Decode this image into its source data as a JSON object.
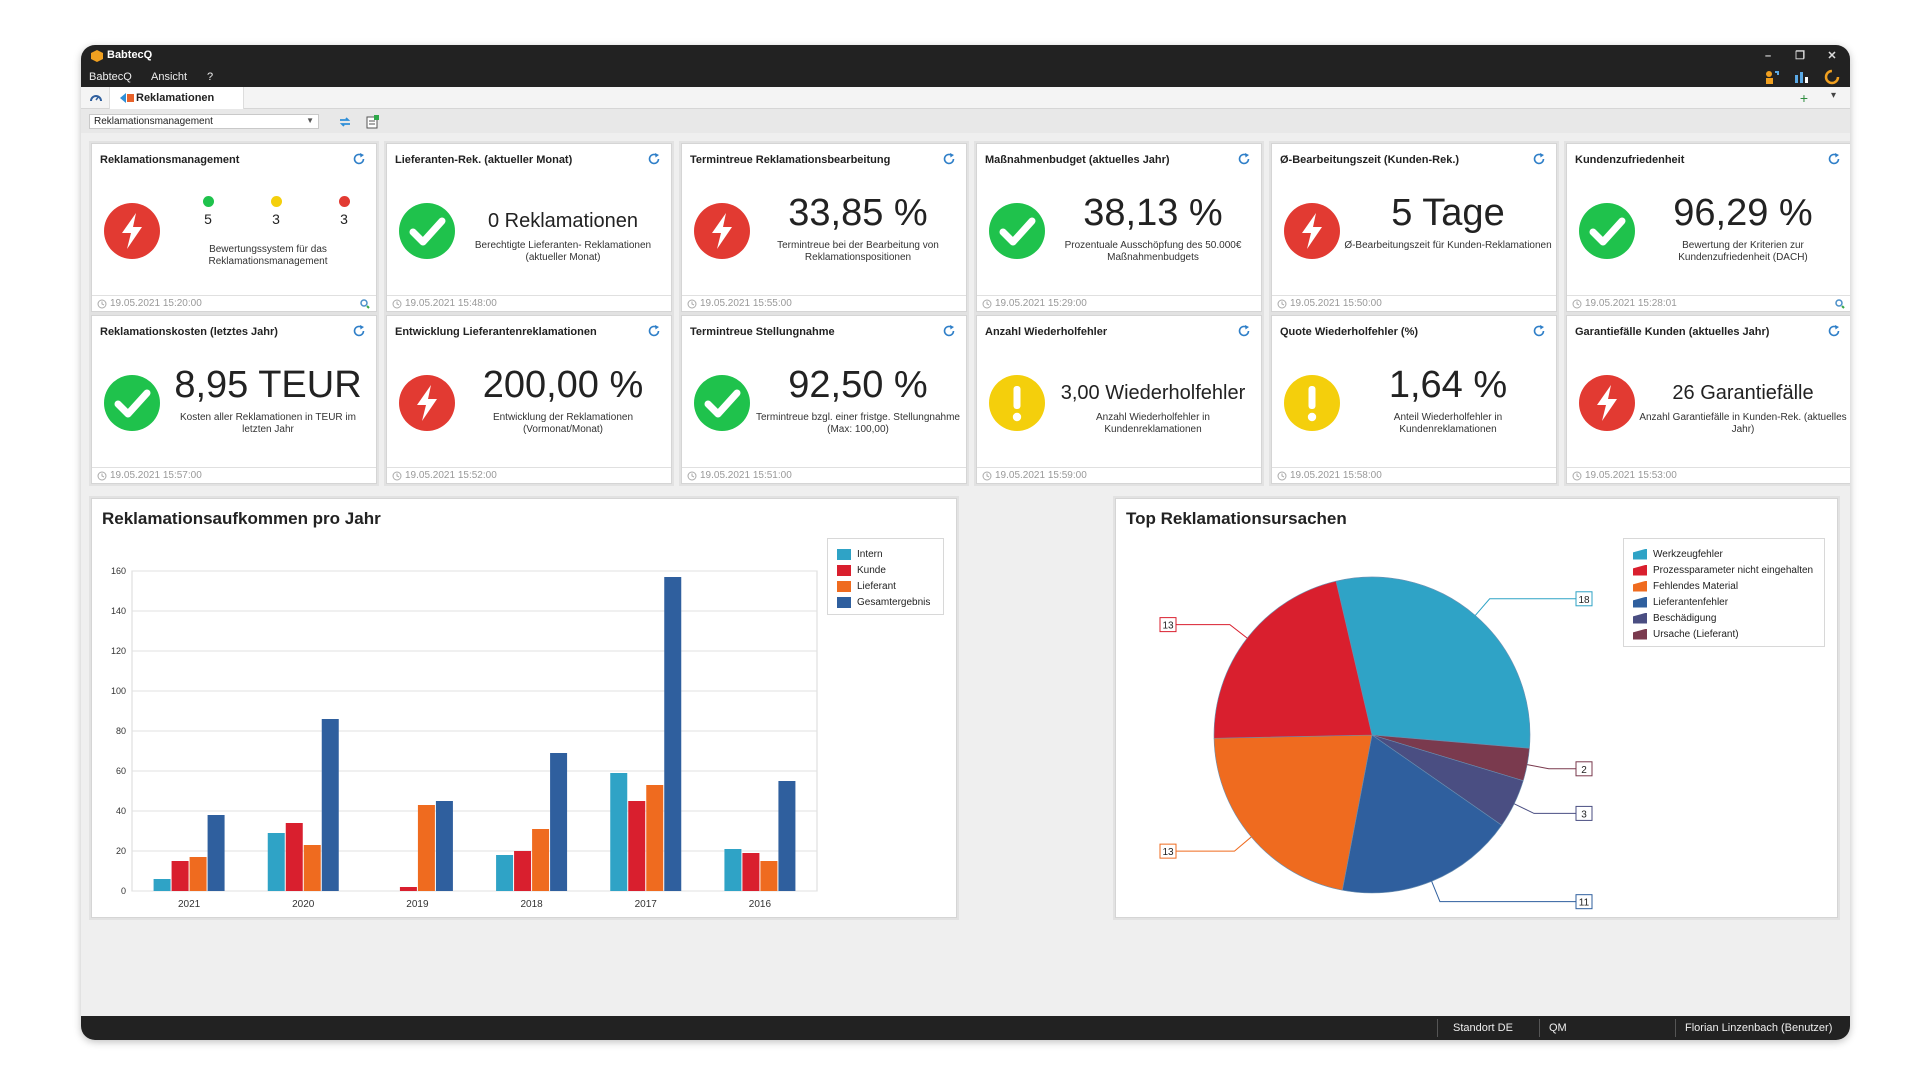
{
  "window": {
    "title": "BabtecQ",
    "controls": {
      "minimize": "–",
      "restore": "❐",
      "close": "✕"
    }
  },
  "menu": {
    "items": [
      "BabtecQ",
      "Ansicht",
      "?"
    ]
  },
  "tabs": {
    "active": "Reklamationen",
    "add": "+",
    "more": "▾"
  },
  "toolbar": {
    "dashboard_select": "Reklamationsmanagement"
  },
  "colors": {
    "red": "#e23a32",
    "green": "#1fc24c",
    "yellow": "#f4cf0c",
    "intern": "#2fa3c6",
    "kunde": "#d91f2e",
    "lieferant": "#ef6b1f",
    "gesamt": "#2f5f9e"
  },
  "tiles": [
    {
      "title": "Reklamationsmanagement",
      "status": "red",
      "traffic": {
        "green": "5",
        "yellow": "3",
        "red": "3"
      },
      "desc": "Bewertungssystem für das Reklamationsmanagement",
      "timestamp": "19.05.2021 15:20:00"
    },
    {
      "title": "Lieferanten-Rek. (aktueller Monat)",
      "status": "green",
      "value": "0 Reklamationen",
      "desc": "Berechtigte Lieferanten- Reklamationen (aktueller Monat)",
      "timestamp": "19.05.2021 15:48:00"
    },
    {
      "title": "Termintreue Reklamationsbearbeitung",
      "status": "red",
      "value": "33,85 %",
      "desc": "Termintreue bei der Bearbeitung von Reklamationspositionen",
      "timestamp": "19.05.2021 15:55:00"
    },
    {
      "title": "Maßnahmenbudget (aktuelles Jahr)",
      "status": "green",
      "value": "38,13 %",
      "desc": "Prozentuale Ausschöpfung des 50.000€ Maßnahmenbudgets",
      "timestamp": "19.05.2021 15:29:00"
    },
    {
      "title": "Ø-Bearbeitungszeit (Kunden-Rek.)",
      "status": "red",
      "value": "5 Tage",
      "desc": "Ø-Bearbeitungszeit für Kunden-Reklamationen",
      "timestamp": "19.05.2021 15:50:00"
    },
    {
      "title": "Kundenzufriedenheit",
      "status": "green",
      "value": "96,29 %",
      "desc": "Bewertung der Kriterien zur Kundenzufriedenheit (DACH)",
      "timestamp": "19.05.2021 15:28:01"
    },
    {
      "title": "Reklamationskosten (letztes Jahr)",
      "status": "green",
      "value": "8,95 TEUR",
      "desc": "Kosten aller Reklamationen in TEUR im letzten Jahr",
      "timestamp": "19.05.2021 15:57:00"
    },
    {
      "title": "Entwicklung Lieferantenreklamationen",
      "status": "red",
      "value": "200,00 %",
      "desc": "Entwicklung der Reklamationen (Vormonat/Monat)",
      "timestamp": "19.05.2021 15:52:00"
    },
    {
      "title": "Termintreue Stellungnahme",
      "status": "green",
      "value": "92,50 %",
      "desc": "Termintreue bzgl. einer fristge. Stellungnahme (Max: 100,00)",
      "timestamp": "19.05.2021 15:51:00"
    },
    {
      "title": "Anzahl Wiederholfehler",
      "status": "yellow",
      "value": "3,00 Wiederholfehler",
      "desc": "Anzahl Wiederholfehler in Kundenreklamationen",
      "timestamp": "19.05.2021 15:59:00"
    },
    {
      "title": "Quote Wiederholfehler (%)",
      "status": "yellow",
      "value": "1,64 %",
      "desc": "Anteil Wiederholfehler in Kundenreklamationen",
      "timestamp": "19.05.2021 15:58:00"
    },
    {
      "title": "Garantiefälle Kunden (aktuelles Jahr)",
      "status": "red",
      "value": "26 Garantiefälle",
      "desc": "Anzahl Garantiefälle in Kunden-Rek. (aktuelles Jahr)",
      "timestamp": "19.05.2021 15:53:00"
    }
  ],
  "chart_data": [
    {
      "type": "bar",
      "title": "Reklamationsaufkommen pro Jahr",
      "categories": [
        "2021",
        "2020",
        "2019",
        "2018",
        "2017",
        "2016"
      ],
      "series": [
        {
          "name": "Intern",
          "color": "#2fa3c6",
          "values": [
            6,
            29,
            0,
            18,
            59,
            21
          ]
        },
        {
          "name": "Kunde",
          "color": "#d91f2e",
          "values": [
            15,
            34,
            2,
            20,
            45,
            19
          ]
        },
        {
          "name": "Lieferant",
          "color": "#ef6b1f",
          "values": [
            17,
            23,
            43,
            31,
            53,
            15
          ]
        },
        {
          "name": "Gesamtergebnis",
          "color": "#2f5f9e",
          "values": [
            38,
            86,
            45,
            69,
            157,
            55
          ]
        }
      ],
      "ylim": [
        0,
        160
      ],
      "yticks": [
        "0",
        "20",
        "40",
        "60",
        "80",
        "100",
        "120",
        "140",
        "160"
      ],
      "grid": true,
      "legend_position": "right"
    },
    {
      "type": "pie",
      "title": "Top Reklamationsursachen",
      "slices": [
        {
          "name": "Werkzeugfehler",
          "value": 18,
          "color": "#2fa3c6"
        },
        {
          "name": "Prozessparameter nicht eingehalten",
          "value": 13,
          "color": "#d91f2e"
        },
        {
          "name": "Fehlendes Material",
          "value": 13,
          "color": "#ef6b1f"
        },
        {
          "name": "Lieferantenfehler",
          "value": 11,
          "color": "#2f5f9e"
        },
        {
          "name": "Beschädigung",
          "value": 3,
          "color": "#4a4e82"
        },
        {
          "name": "Ursache (Lieferant)",
          "value": 2,
          "color": "#7a3a4e"
        }
      ],
      "legend_position": "top-right"
    }
  ],
  "statusbar": {
    "location": "Standort DE",
    "module": "QM",
    "user": "Florian Linzenbach (Benutzer)"
  }
}
